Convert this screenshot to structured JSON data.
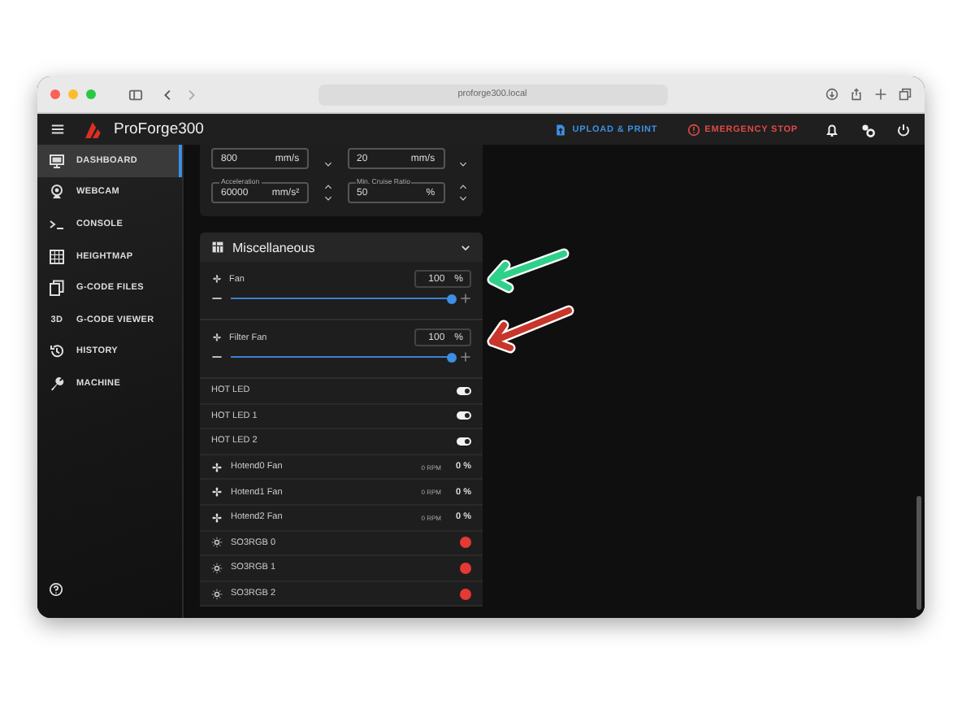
{
  "browser": {
    "url": "proforge300.local"
  },
  "app_bar": {
    "title": "ProForge300",
    "actions": [
      {
        "kind": "upload",
        "label": "UPLOAD & PRINT"
      },
      {
        "kind": "stop",
        "label": "EMERGENCY STOP"
      }
    ]
  },
  "sidebar": {
    "items": [
      {
        "label": "DASHBOARD",
        "selected": true
      },
      {
        "label": "WEBCAM",
        "selected": false
      },
      {
        "label": "CONSOLE",
        "selected": false
      },
      {
        "label": "HEIGHTMAP",
        "selected": false
      },
      {
        "label": "G-CODE FILES",
        "selected": false
      },
      {
        "label": "G-CODE VIEWER",
        "icon_text": "3D",
        "selected": false
      },
      {
        "label": "HISTORY",
        "selected": false
      },
      {
        "label": "MACHINE",
        "selected": false
      }
    ]
  },
  "motion_fields": [
    {
      "value": "800",
      "unit": "mm/s"
    },
    {
      "value": "20",
      "unit": "mm/s"
    },
    {
      "label": "Acceleration",
      "value": "60000",
      "unit": "mm/s²"
    },
    {
      "label": "Min. Cruise Ratio",
      "value": "50",
      "unit": "%"
    }
  ],
  "misc": {
    "title": "Miscellaneous",
    "expanded": true,
    "sliders": [
      {
        "label": "Fan",
        "value": "100",
        "unit": "%",
        "level": 1
      },
      {
        "label": "Filter Fan",
        "value": "100",
        "unit": "%",
        "level": 1
      }
    ],
    "rows": [
      {
        "kind": "toggle",
        "label": "HOT LED",
        "on": true
      },
      {
        "kind": "toggle",
        "label": "HOT LED 1",
        "on": true
      },
      {
        "kind": "toggle",
        "label": "HOT LED 2",
        "on": true
      },
      {
        "kind": "fan",
        "label": "Hotend0 Fan",
        "rpm": "0 RPM",
        "percent": "0 %"
      },
      {
        "kind": "fan",
        "label": "Hotend1 Fan",
        "rpm": "0 RPM",
        "percent": "0 %"
      },
      {
        "kind": "fan",
        "label": "Hotend2 Fan",
        "rpm": "0 RPM",
        "percent": "0 %"
      },
      {
        "kind": "light",
        "label": "SO3RGB 0",
        "color": "#e53935"
      },
      {
        "kind": "light",
        "label": "SO3RGB 1",
        "color": "#e53935"
      },
      {
        "kind": "light",
        "label": "SO3RGB 2",
        "color": "#e53935"
      }
    ]
  },
  "annotation_arrows": [
    {
      "color": "#2ed18a"
    },
    {
      "color": "#c8352a"
    }
  ]
}
